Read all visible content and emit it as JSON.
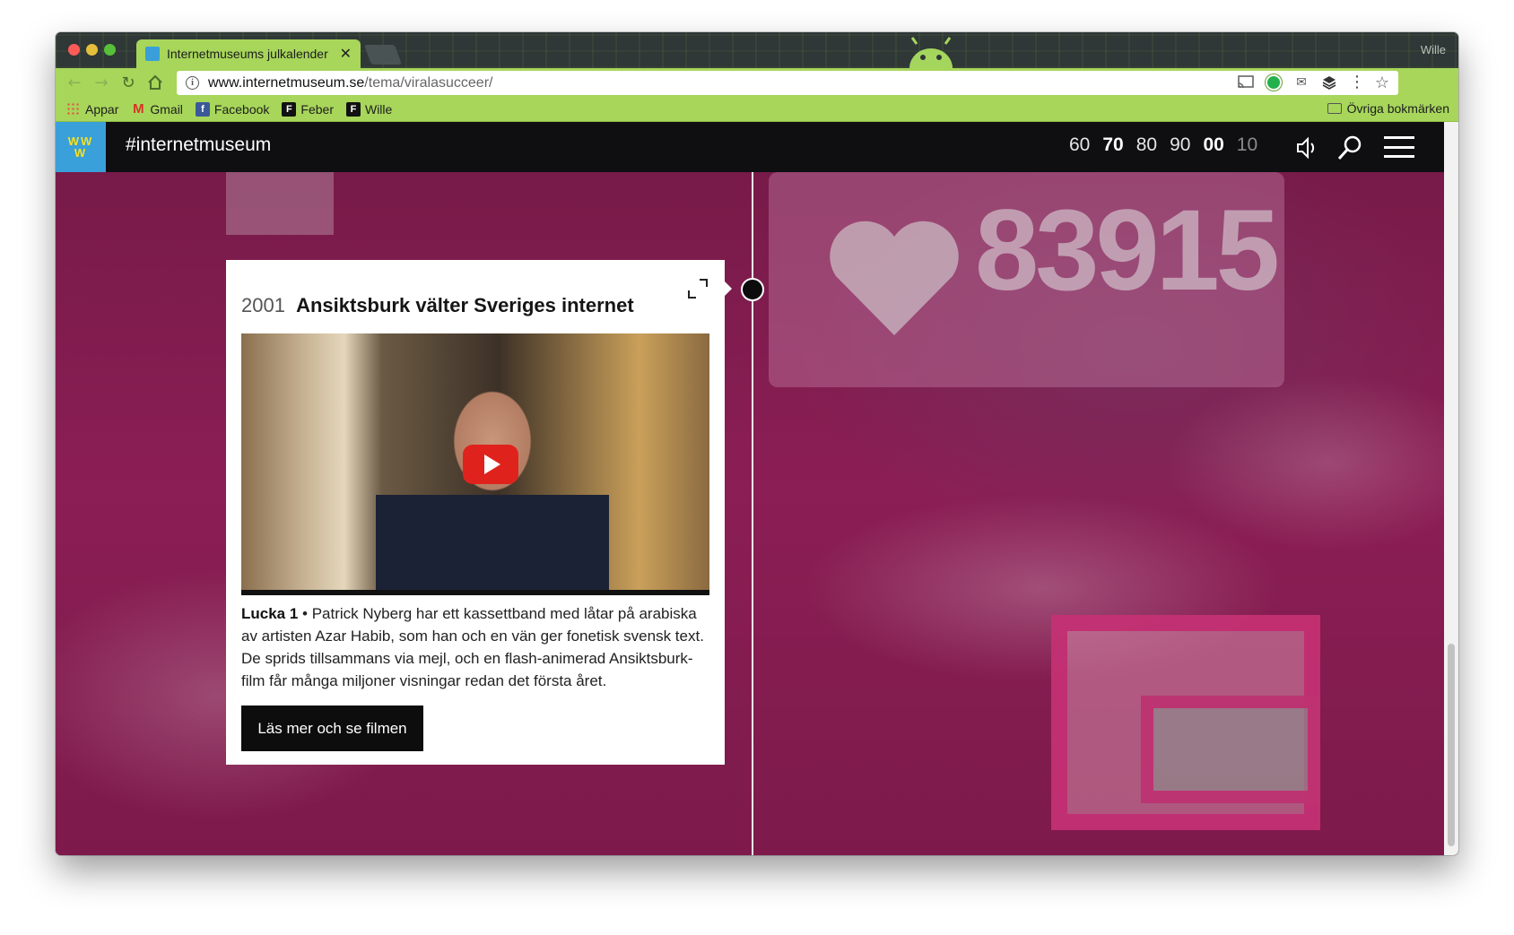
{
  "browser": {
    "tab_title": "Internetmuseums julkalender",
    "profile_name": "Wille",
    "url_host": "www.internetmuseum.se",
    "url_path": "/tema/viralasucceer/",
    "bookmarks": [
      {
        "label": "Appar"
      },
      {
        "label": "Gmail"
      },
      {
        "label": "Facebook"
      },
      {
        "label": "Feber"
      },
      {
        "label": "Wille"
      }
    ],
    "other_bookmarks": "Övriga bokmärken",
    "accent_color": "#a7d65a"
  },
  "site": {
    "logo_top": "WW",
    "logo_bottom": "W",
    "name": "#internetmuseum",
    "decades": [
      "60",
      "70",
      "80",
      "90",
      "00",
      "10"
    ],
    "background_counter": "83915"
  },
  "card": {
    "year": "2001",
    "headline": "Ansiktsburk välter Sveriges internet",
    "lead_label": "Lucka 1",
    "separator": " • ",
    "body": "Patrick Nyberg har ett kassettband med låtar på arabiska av artisten Azar Habib, som han och en vän ger fonetisk svensk text. De sprids tillsammans via mejl, och en flash-animerad Ansiktsburk-film får många miljoner visningar redan det första året.",
    "button_label": "Läs mer och se filmen"
  }
}
